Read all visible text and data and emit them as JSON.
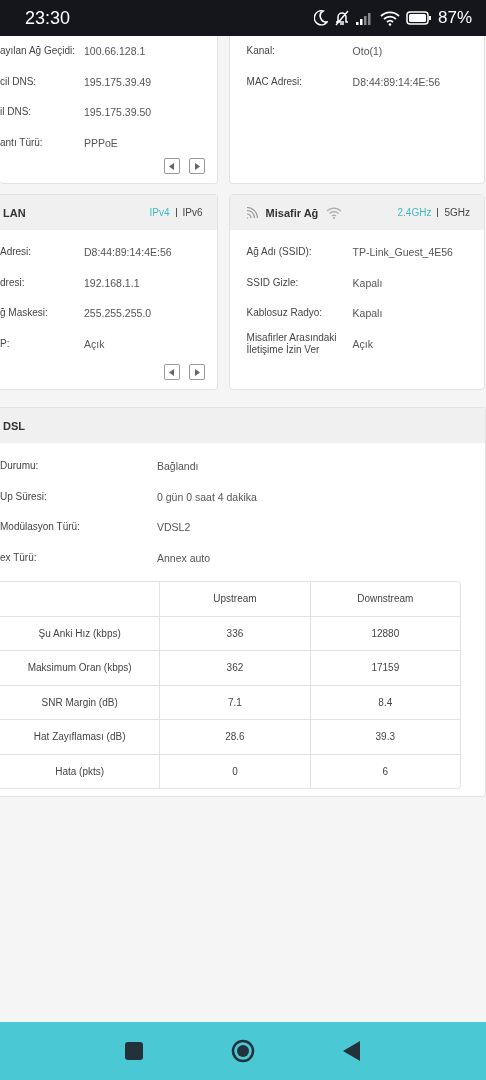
{
  "status_bar": {
    "time": "23:30",
    "battery": "87%"
  },
  "wan_card": {
    "rows": [
      {
        "label": "ayılan Ağ Geçidi:",
        "value": "100.66.128.1"
      },
      {
        "label": "cil DNS:",
        "value": "195.175.39.49"
      },
      {
        "label": "il DNS:",
        "value": "195.175.39.50"
      },
      {
        "label": "antı Türü:",
        "value": "PPPoE"
      }
    ]
  },
  "wireless_card": {
    "rows": [
      {
        "label": "Kanal:",
        "value": "Oto(1)"
      },
      {
        "label": "MAC Adresi:",
        "value": "D8:44:89:14:4E:56"
      }
    ]
  },
  "lan_card": {
    "title": "LAN",
    "tabs": [
      {
        "label": "IPv4",
        "selected": true
      },
      {
        "label": "IPv6",
        "selected": false
      }
    ],
    "rows": [
      {
        "label": "Adresi:",
        "value": "D8:44:89:14:4E:56"
      },
      {
        "label": "dresi:",
        "value": "192.168.1.1"
      },
      {
        "label": "ğ Maskesi:",
        "value": "255.255.255.0"
      },
      {
        "label": "P:",
        "value": "Açık"
      }
    ]
  },
  "guest_card": {
    "title": "Misafir Ağ",
    "tabs": [
      {
        "label": "2.4GHz",
        "selected": true
      },
      {
        "label": "5GHz",
        "selected": false
      }
    ],
    "rows": [
      {
        "label": "Ağ Adı (SSID):",
        "value": "TP-Link_Guest_4E56"
      },
      {
        "label": "SSID Gizle:",
        "value": "Kapalı"
      },
      {
        "label": "Kablosuz Radyo:",
        "value": "Kapalı"
      },
      {
        "label": "Misafirler Arasındaki İletişime İzin Ver",
        "value": "Açık"
      }
    ]
  },
  "dsl_card": {
    "title": "DSL",
    "rows": [
      {
        "label": "Durumu:",
        "value": "Bağlandı"
      },
      {
        "label": "Up Süresi:",
        "value": "0 gün 0 saat 4 dakika"
      },
      {
        "label": "Modülasyon Türü:",
        "value": "VDSL2"
      },
      {
        "label": "ex Türü:",
        "value": "Annex auto"
      }
    ],
    "table": {
      "columns": [
        "Upstream",
        "Downstream"
      ],
      "rows": [
        {
          "name": "Şu Anki Hız (kbps)",
          "upstream": "336",
          "downstream": "12880"
        },
        {
          "name": "Maksimum Oran (kbps)",
          "upstream": "362",
          "downstream": "17159"
        },
        {
          "name": "SNR Margin (dB)",
          "upstream": "7.1",
          "downstream": "8.4"
        },
        {
          "name": "Hat Zayıflaması (dB)",
          "upstream": "28.6",
          "downstream": "39.3"
        },
        {
          "name": "Hata (pkts)",
          "upstream": "0",
          "downstream": "6"
        }
      ]
    }
  }
}
